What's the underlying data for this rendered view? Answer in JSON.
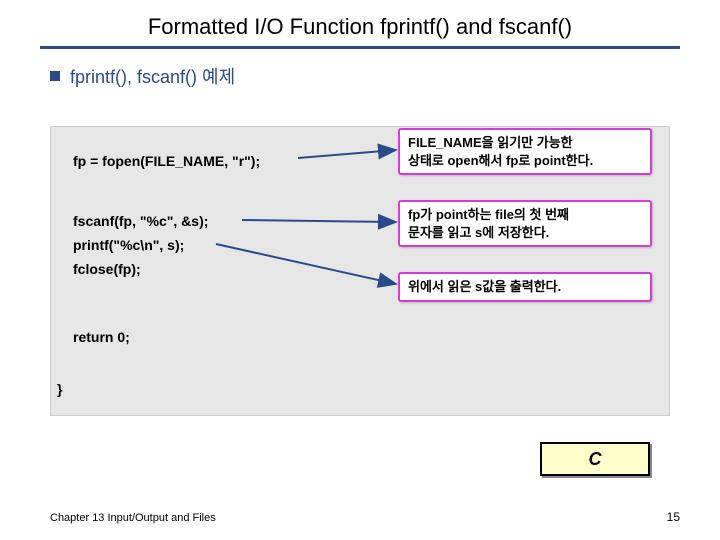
{
  "title": "Formatted I/O Function fprintf() and fscanf()",
  "subtitle": "fprintf(), fscanf() 예제",
  "code": {
    "l1": "fp = fopen(FILE_NAME, \"r\");",
    "l2": "fscanf(fp, \"%c\", &s);",
    "l3": "printf(\"%c\\n\", s);",
    "l4": "fclose(fp);",
    "l5": "return 0;",
    "l6": "}"
  },
  "callouts": {
    "c1_line1": "FILE_NAME을 읽기만 가능한",
    "c1_line2": "상태로 open해서 fp로 point한다.",
    "c2_line1": "fp가 point하는 file의 첫 번째",
    "c2_line2": "문자를 읽고 s에 저장한다.",
    "c3": "위에서 읽은 s값을 출력한다."
  },
  "output": "C",
  "footer_left": "Chapter 13  Input/Output and Files",
  "footer_right": "15"
}
